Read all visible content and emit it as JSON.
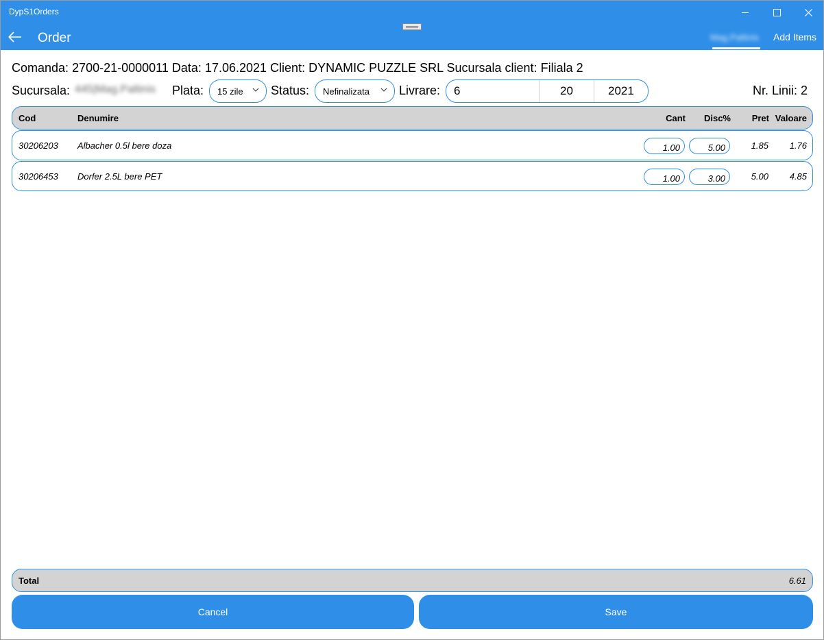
{
  "window": {
    "app_title": "DypS1Orders"
  },
  "header": {
    "page_title": "Order",
    "branch_tab": "Mag.Paltinis",
    "add_items_label": "Add Items"
  },
  "order": {
    "comanda_label": "Comanda:",
    "comanda_value": "2700-21-0000011",
    "data_label": "Data:",
    "data_value": "17.06.2021",
    "client_label": "Client:",
    "client_value": "DYNAMIC PUZZLE SRL",
    "sucursala_client_label": "Sucursala client:",
    "sucursala_client_value": "Filiala 2",
    "sucursala_label": "Sucursala:",
    "sucursala_value": "445|Mag.Paltinis",
    "plata_label": "Plata:",
    "plata_value": "15 zile",
    "status_label": "Status:",
    "status_value": "Nefinalizata",
    "livrare_label": "Livrare:",
    "livrare": {
      "month": "6",
      "day": "20",
      "year": "2021"
    },
    "nr_linii_label": "Nr. Linii:",
    "nr_linii_value": "2"
  },
  "columns": {
    "cod": "Cod",
    "denumire": "Denumire",
    "cant": "Cant",
    "disc": "Disc%",
    "pret": "Pret",
    "valoare": "Valoare"
  },
  "rows": [
    {
      "cod": "30206203",
      "denumire": "Albacher 0.5l bere doza",
      "cant": "1.00",
      "disc": "5.00",
      "pret": "1.85",
      "valoare": "1.76"
    },
    {
      "cod": "30206453",
      "denumire": "Dorfer 2.5L bere PET",
      "cant": "1.00",
      "disc": "3.00",
      "pret": "5.00",
      "valoare": "4.85"
    }
  ],
  "total": {
    "label": "Total",
    "value": "6.61"
  },
  "buttons": {
    "cancel": "Cancel",
    "save": "Save"
  },
  "colors": {
    "accent": "#2f8fe8",
    "header_gray": "#d3d3d3"
  },
  "icons": {
    "back": "arrow-left-icon",
    "minimize": "minimize-icon",
    "maximize": "maximize-icon",
    "close": "close-icon",
    "chevron": "chevron-down-icon"
  }
}
